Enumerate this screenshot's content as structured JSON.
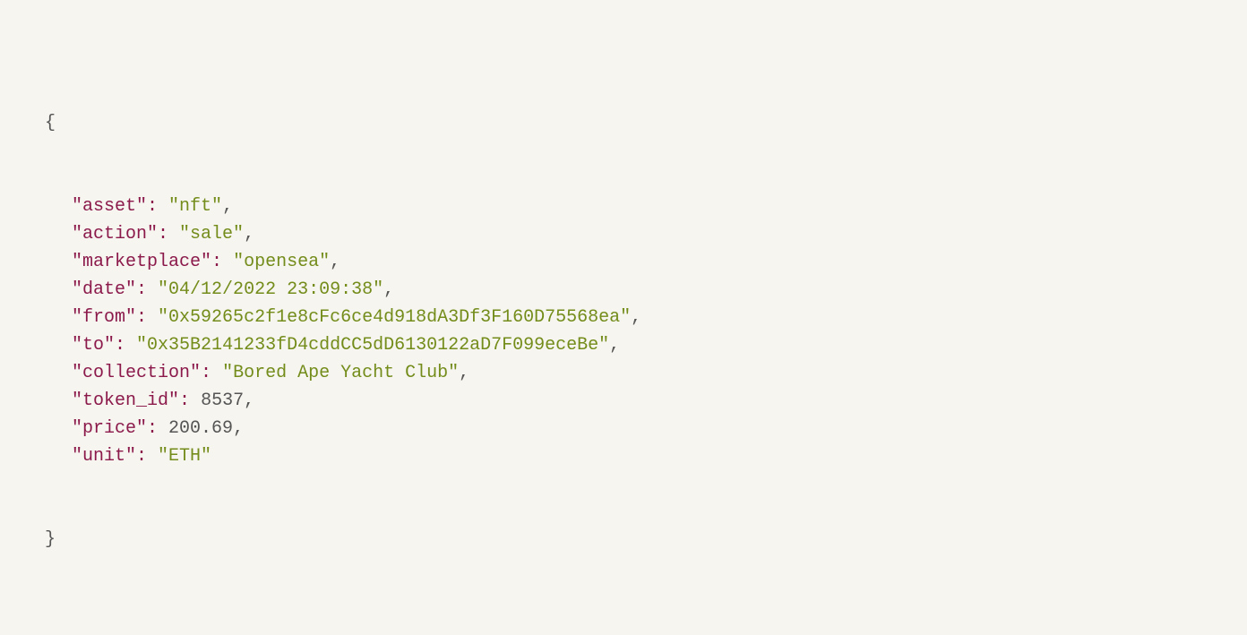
{
  "json_display": {
    "open_brace": "{",
    "close_brace": "}",
    "entries": [
      {
        "key": "\"asset\"",
        "colon": ":",
        "value": "\"nft\"",
        "type": "str",
        "comma": ","
      },
      {
        "key": "\"action\"",
        "colon": ":",
        "value": "\"sale\"",
        "type": "str",
        "comma": ","
      },
      {
        "key": "\"marketplace\"",
        "colon": ":",
        "value": "\"opensea\"",
        "type": "str",
        "comma": ","
      },
      {
        "key": "\"date\"",
        "colon": ":",
        "value": "\"04/12/2022 23:09:38\"",
        "type": "str",
        "comma": ","
      },
      {
        "key": "\"from\"",
        "colon": ":",
        "value": "\"0x59265c2f1e8cFc6ce4d918dA3Df3F160D75568ea\"",
        "type": "str",
        "comma": ","
      },
      {
        "key": "\"to\"",
        "colon": ":",
        "value": "\"0x35B2141233fD4cddCC5dD6130122aD7F099eceBe\"",
        "type": "str",
        "comma": ","
      },
      {
        "key": "\"collection\"",
        "colon": ":",
        "value": "\"Bored Ape Yacht Club\"",
        "type": "str",
        "comma": ","
      },
      {
        "key": "\"token_id\"",
        "colon": ":",
        "value": "8537",
        "type": "num",
        "comma": ","
      },
      {
        "key": "\"price\"",
        "colon": ":",
        "value": "200.69",
        "type": "num",
        "comma": ","
      },
      {
        "key": "\"unit\"",
        "colon": ":",
        "value": "\"ETH\"",
        "type": "str",
        "comma": ""
      }
    ]
  }
}
